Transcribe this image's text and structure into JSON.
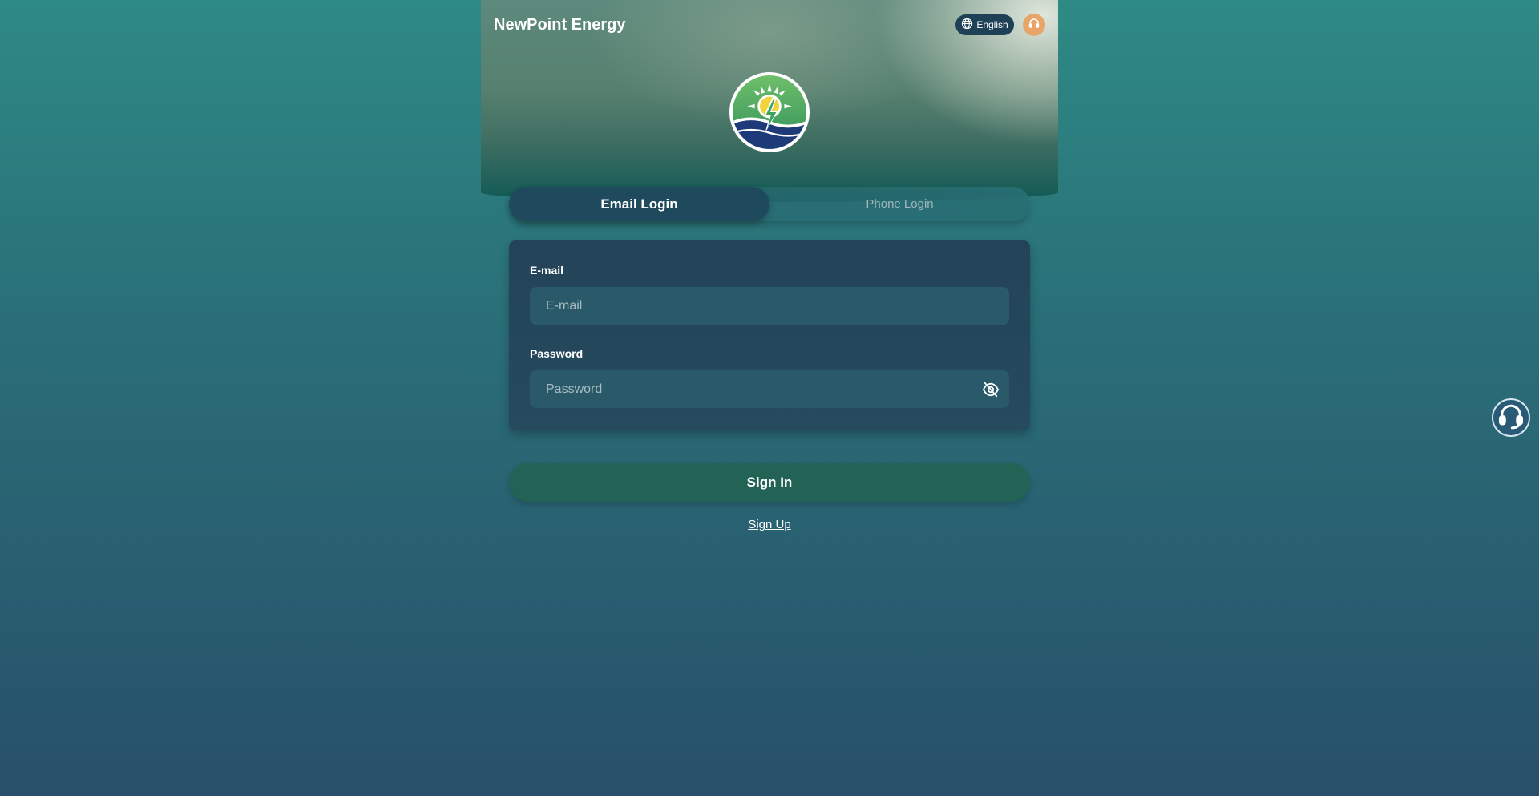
{
  "header": {
    "brand": "NewPoint Energy",
    "language_label": "English",
    "language_icon": "globe-icon",
    "support_icon": "headset-icon"
  },
  "logo": {
    "icon": "sun-lightning-wave-logo"
  },
  "tabs": [
    {
      "label": "Email Login",
      "active": true
    },
    {
      "label": "Phone Login",
      "active": false
    }
  ],
  "form": {
    "email_label": "E-mail",
    "email_placeholder": "E-mail",
    "email_value": "",
    "password_label": "Password",
    "password_placeholder": "Password",
    "password_value": "",
    "password_toggle_icon": "eye-off-icon"
  },
  "actions": {
    "sign_in": "Sign In",
    "sign_up": "Sign Up"
  },
  "floating": {
    "support_icon": "headset-icon"
  },
  "colors": {
    "accent": "#236356",
    "tab_active": "#1f4a5e",
    "card": "#234359",
    "support_orange": "#e8a56a"
  }
}
